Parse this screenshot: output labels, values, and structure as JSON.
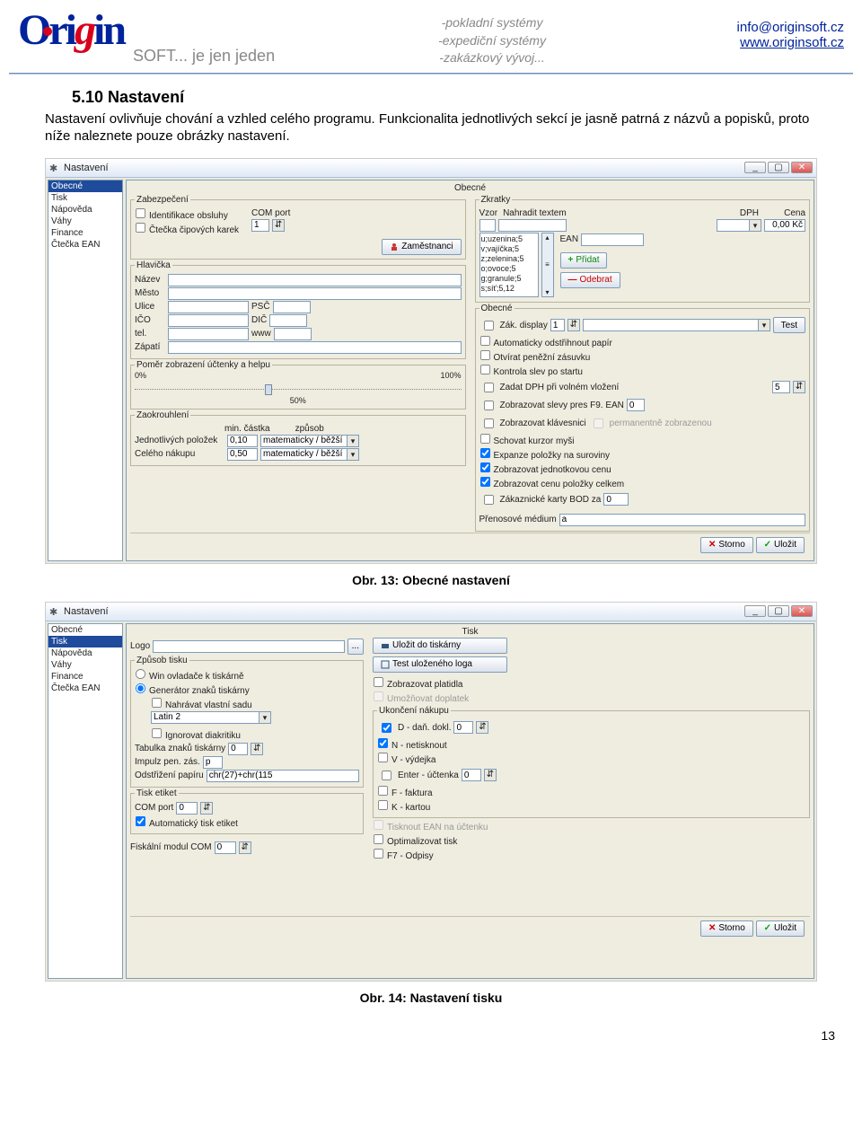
{
  "header": {
    "logo_main": "Origin",
    "logo_sub": "SOFT... je jen jeden",
    "center": {
      "l1": "-pokladní systémy",
      "l2": "-expediční systémy",
      "l3": "-zakázkový vývoj..."
    },
    "email": "info@originsoft.cz",
    "web": "www.originsoft.cz"
  },
  "section": {
    "title": "5.10 Nastavení",
    "para": "Nastavení ovlivňuje chování a vzhled celého programu. Funkcionalita jednotlivých sekcí je jasně patrná z názvů a popisků, proto níže naleznete pouze obrázky nastavení."
  },
  "fig1": {
    "caption": "Obr. 13: Obecné nastavení",
    "wintitle": "Nastavení",
    "sidebar": [
      "Obecné",
      "Tisk",
      "Nápověda",
      "Váhy",
      "Finance",
      "Čtečka EAN"
    ],
    "sidebar_sel": 0,
    "maintitle": "Obecné",
    "zabezpeceni": {
      "legend": "Zabezpečení",
      "ident": "Identifikace obsluhy",
      "ctecka": "Čtečka čipových karek",
      "com": "COM port",
      "ctecka_val": "1",
      "zamest": "Zaměstnanci"
    },
    "hlavicka": {
      "legend": "Hlavička",
      "nazev": "Název",
      "mesto": "Město",
      "ulice": "Ulice",
      "psc": "PSČ",
      "ico": "IČO",
      "dic": "DIČ",
      "tel": "tel.",
      "www": "www",
      "zapati": "Zápatí"
    },
    "pomer": {
      "legend": "Poměr zobrazení účtenky a helpu",
      "l": "0%",
      "r": "100%",
      "m": "50%"
    },
    "zaokrouhleni": {
      "legend": "Zaokrouhlení",
      "mincastka": "min. částka",
      "zpusob": "způsob",
      "jednot": "Jednotlivých položek",
      "jednot_val": "0,10",
      "jednot_mode": "matematicky / běžší",
      "celeho": "Celého nákupu",
      "celeho_val": "0,50",
      "celeho_mode": "matematicky / běžší"
    },
    "zkratky": {
      "legend": "Zkratky",
      "vzor": "Vzor",
      "nahradit": "Nahradit textem",
      "dph": "DPH",
      "cena": "Cena",
      "cena_val": "0,00 Kč",
      "ean": "EAN",
      "pridat": "Přidat",
      "odebrat": "Odebrat",
      "items": [
        "u;uzenina;5",
        "v;vajíčka;5",
        "z;zelenina;5",
        "o;ovoce;5",
        "g;granule;5",
        "s;síť;5,12"
      ]
    },
    "obecne": {
      "legend": "Obecné",
      "zakdisplay": "Zák. display",
      "zakdisplay_val": "1",
      "test": "Test",
      "auto_papir": "Automaticky odstřihnout papír",
      "otv_zasuvku": "Otvírat peněžní zásuvku",
      "kontrola_slev": "Kontrola slev po startu",
      "zadat_dph": "Zadat DPH při volném vložení",
      "zadat_dph_val": "5",
      "zobr_slevy": "Zobrazovat slevy pres F9. EAN",
      "zobr_slevy_val": "0",
      "zobr_klav": "Zobrazovat klávesnici",
      "perm_zobr": "permanentně zobrazenou",
      "schovat_kurzor": "Schovat kurzor myši",
      "exp_polozky": "Expanze položky na suroviny",
      "zobr_jedn": "Zobrazovat jednotkovou cenu",
      "zobr_celkem": "Zobrazovat cenu položky celkem",
      "zak_karty": "Zákaznické karty BOD za",
      "zak_val": "0",
      "pren_med": "Přenosové médium",
      "pren_val": "a"
    },
    "storno": "Storno",
    "ulozit": "Uložit"
  },
  "fig2": {
    "caption": "Obr. 14: Nastavení tisku",
    "wintitle": "Nastavení",
    "sidebar": [
      "Obecné",
      "Tisk",
      "Nápověda",
      "Váhy",
      "Finance",
      "Čtečka EAN"
    ],
    "sidebar_sel": 1,
    "maintitle": "Tisk",
    "logo": "Logo",
    "logo_btn": "...",
    "ulozit_tisk": "Uložit do tiskárny",
    "test_loga": "Test uloženého loga",
    "zpusob": {
      "legend": "Způsob tisku",
      "win": "Win ovladače k tiskárně",
      "gen": "Generátor znaků tiskárny",
      "nahravat": "Nahrávat vlastní sadu",
      "latin": "Latin 2",
      "ign": "Ignorovat diakritiku",
      "tabulka": "Tabulka znaků tiskárny",
      "tabulka_val": "0",
      "impulz": "Impulz pen. zás.",
      "impulz_val": "p",
      "odstrih": "Odstřižení papíru",
      "odstrih_val": "chr(27)+chr(115"
    },
    "tisketiket": {
      "legend": "Tisk etiket",
      "com": "COM port",
      "com_val": "0",
      "auto": "Automatický tisk etiket"
    },
    "fiskalni": "Fiskální modul COM",
    "fiskalni_val": "0",
    "zobr_platidla": "Zobrazovat platidla",
    "dopln": "Umožňovat doplatek",
    "ukonceni": {
      "legend": "Ukončení nákupu",
      "d": "D - daň. dokl.",
      "d_val": "0",
      "n": "N - netisknout",
      "v": "V - výdejka",
      "enter": "Enter - účtenka",
      "enter_val": "0",
      "f": "F - faktura",
      "k": "K - kartou"
    },
    "tisk_ean": "Tisknout EAN na účtenku",
    "opt": "Optimalizovat tisk",
    "f7": "F7 - Odpisy",
    "storno": "Storno",
    "ulozit": "Uložit"
  },
  "page_num": "13"
}
